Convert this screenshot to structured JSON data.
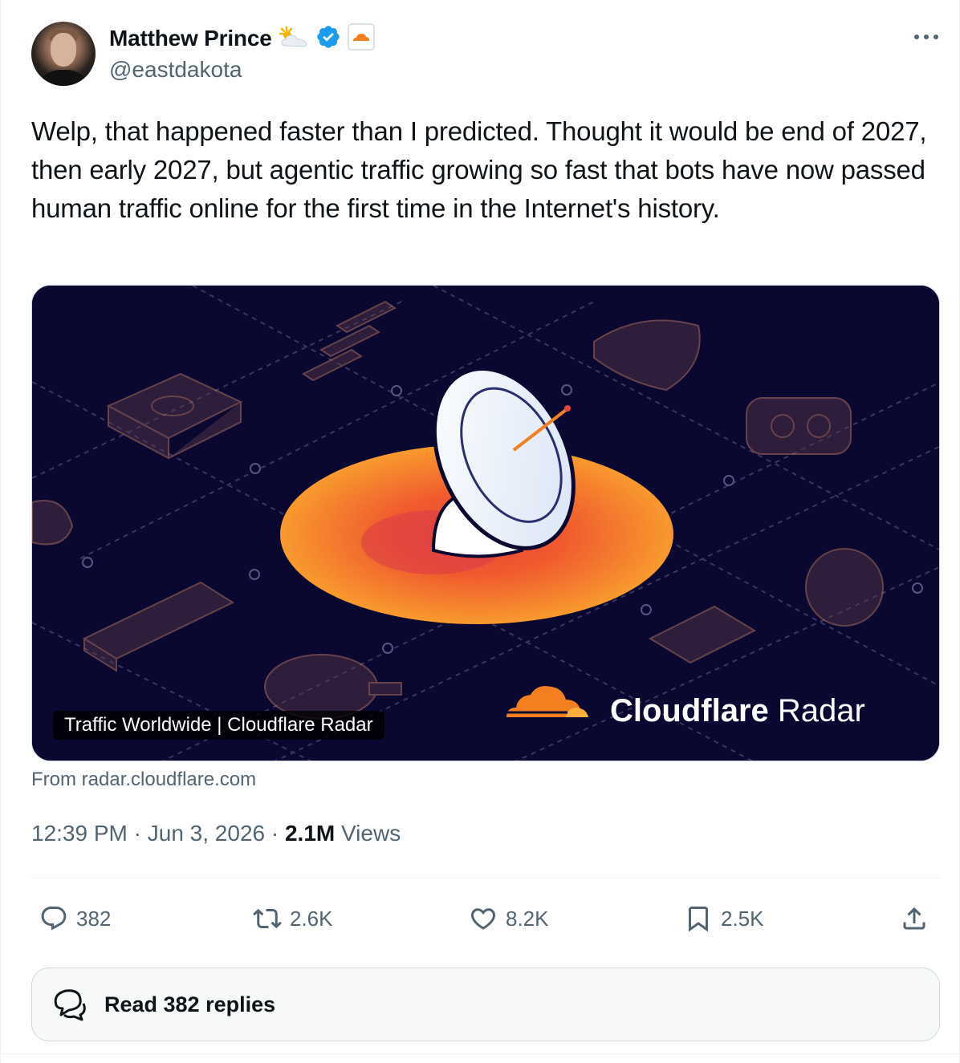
{
  "author": {
    "name": "Matthew Prince",
    "handle": "@eastdakota",
    "badge_icons": [
      "sun-behind-cloud-icon",
      "verified-badge-icon",
      "cloudflare-affiliate-icon"
    ]
  },
  "tweet": {
    "text": "Welp, that happened faster than I predicted. Thought it would be end of 2027, then early 2027, but agentic traffic growing so fast that bots have now passed human traffic online for the first time in the Internet's history."
  },
  "card": {
    "caption": "Traffic Worldwide | Cloudflare Radar",
    "brand_bold": "Cloudflare",
    "brand_light": "Radar",
    "source": "From radar.cloudflare.com"
  },
  "meta": {
    "time": "12:39 PM",
    "date": "Jun 3, 2026",
    "separator": "·",
    "views_count": "2.1M",
    "views_label": "Views"
  },
  "actions": {
    "replies": "382",
    "reposts": "2.6K",
    "likes": "8.2K",
    "bookmarks": "2.5K"
  },
  "read_replies": {
    "label": "Read 382 replies"
  },
  "colors": {
    "text_primary": "#0f1419",
    "text_secondary": "#536471",
    "verified_blue": "#1d9bf0",
    "cloudflare_orange": "#f38020",
    "card_background": "#0a0830"
  }
}
